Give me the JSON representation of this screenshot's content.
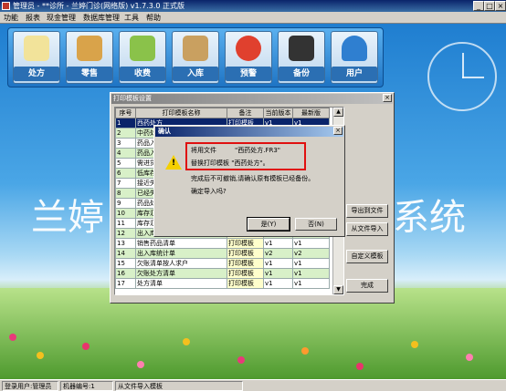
{
  "window": {
    "title": "管理员 - **诊所 - 兰婷门诊(网络版) v1.7.3.0 正式版",
    "controls": [
      "_",
      "□",
      "×"
    ]
  },
  "menu": [
    "功能",
    "报表",
    "现金管理",
    "数据库管理",
    "工具",
    "帮助"
  ],
  "toolbar": {
    "buttons": [
      {
        "label": "处方",
        "icon": "prescription-icon"
      },
      {
        "label": "零售",
        "icon": "shopping-cart-icon"
      },
      {
        "label": "收费",
        "icon": "money-icon"
      },
      {
        "label": "入库",
        "icon": "truck-icon"
      },
      {
        "label": "预警",
        "icon": "alarm-clock-icon"
      },
      {
        "label": "备份",
        "icon": "floppy-disk-icon"
      },
      {
        "label": "用户",
        "icon": "user-icon"
      }
    ]
  },
  "background": {
    "text_left": "兰婷",
    "text_right": "系统"
  },
  "print_dialog": {
    "title": "打印模板设置",
    "close": "×",
    "columns": [
      "序号",
      "打印模板名称",
      "备注",
      "当前版本",
      "最新版"
    ],
    "rows": [
      [
        "1",
        "西药处方",
        "打印模板",
        "v1",
        "v1"
      ],
      [
        "2",
        "中药处方",
        "",
        "",
        ""
      ],
      [
        "3",
        "药品入",
        "",
        "",
        ""
      ],
      [
        "4",
        "药品入",
        "",
        "",
        ""
      ],
      [
        "5",
        "需进货",
        "",
        "",
        ""
      ],
      [
        "6",
        "低库存",
        "",
        "",
        ""
      ],
      [
        "7",
        "接近失",
        "",
        "",
        ""
      ],
      [
        "8",
        "已经失",
        "",
        "",
        ""
      ],
      [
        "9",
        "药品处",
        "",
        "",
        ""
      ],
      [
        "10",
        "库存汇",
        "",
        "",
        ""
      ],
      [
        "11",
        "库存汇",
        "",
        "",
        ""
      ],
      [
        "12",
        "出入库",
        "",
        "",
        ""
      ],
      [
        "13",
        "销售药品清单",
        "打印模板",
        "v1",
        "v1"
      ],
      [
        "14",
        "出入库统计单",
        "打印模板",
        "v2",
        "v2"
      ],
      [
        "15",
        "欠账清单按人求户",
        "打印模板",
        "v1",
        "v1"
      ],
      [
        "16",
        "欠账处方清单",
        "打印模板",
        "v1",
        "v1"
      ],
      [
        "17",
        "处方清单",
        "打印模板",
        "v1",
        "v1"
      ]
    ],
    "buttons": {
      "export": "导出到文件",
      "import": "从文件导入",
      "custom": "自定义模板",
      "done": "完成"
    }
  },
  "confirm_dialog": {
    "title": "确认",
    "close": "×",
    "warning_mark": "!",
    "line1_label": "将用文件",
    "line1_value": "\"西药处方.FR3\"",
    "line2": "替换打印模板 \"西药处方\"。",
    "line3": "完成后不可撤销,请确认原有模板已经备份。",
    "line4": "确定导入吗?",
    "yes": "是(Y)",
    "no": "否(N)"
  },
  "status_bar": {
    "user": "登录用户:管理员",
    "machine": "机器编号:1",
    "action": "从文件导入模板"
  }
}
